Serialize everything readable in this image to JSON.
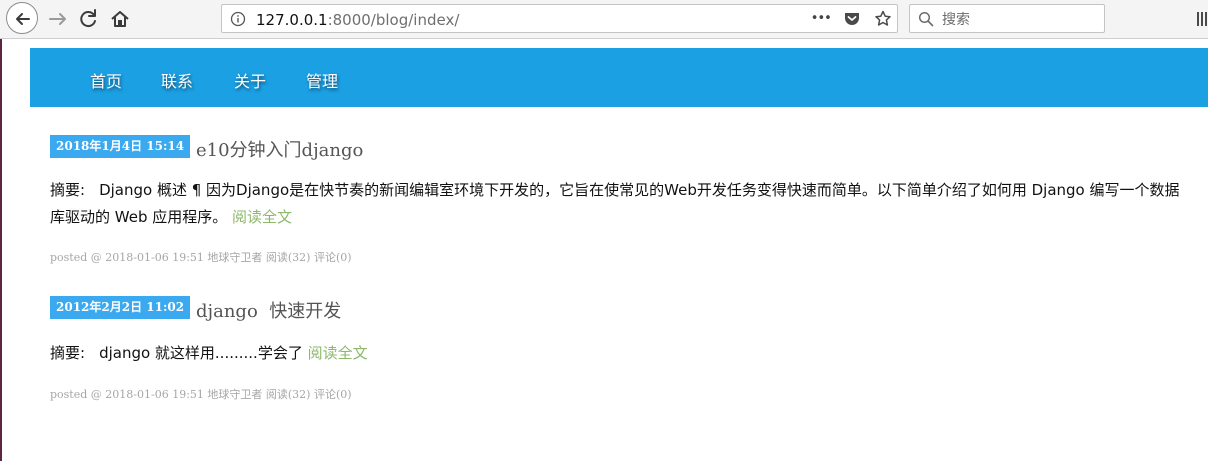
{
  "browser": {
    "url_host": "127.0.0.1",
    "url_rest": ":8000/blog/index/",
    "search_placeholder": "搜索",
    "url_more_glyph": "•••"
  },
  "nav": {
    "items": [
      "首页",
      "联系",
      "关于",
      "管理"
    ]
  },
  "posts": [
    {
      "date": "2018年1月4日 15:14",
      "title": "e10分钟入门django",
      "summary_label": "摘要:",
      "summary_line1": "Django 概述 ¶ 因为Django是在快节奏的新闻编辑室环境下开发的，它旨在使常见的Web开发任务变得快速而简单。以下简单介绍了如何用 Django 编写一个数据",
      "summary_line2": "库驱动的 Web 应用程序。",
      "read_more": "阅读全文",
      "meta": "posted @ 2018-01-06 19:51 地球守卫者 阅读(32) 评论(0)"
    },
    {
      "date": "2012年2月2日 11:02",
      "title": "django  快速开发",
      "summary_label": "摘要:",
      "summary_line1": "django 就这样用.........学会了",
      "read_more": "阅读全文",
      "meta": "posted @ 2018-01-06 19:51 地球守卫者 阅读(32) 评论(0)"
    }
  ],
  "colors": {
    "nav_bg": "#1ca0e4",
    "badge_bg": "#3aa9ef",
    "read_more": "#8db86a"
  },
  "icons": [
    "back-arrow-icon",
    "forward-arrow-icon",
    "reload-icon",
    "home-icon",
    "info-icon",
    "more-icon",
    "pocket-icon",
    "bookmark-star-icon",
    "search-icon",
    "library-icon"
  ]
}
